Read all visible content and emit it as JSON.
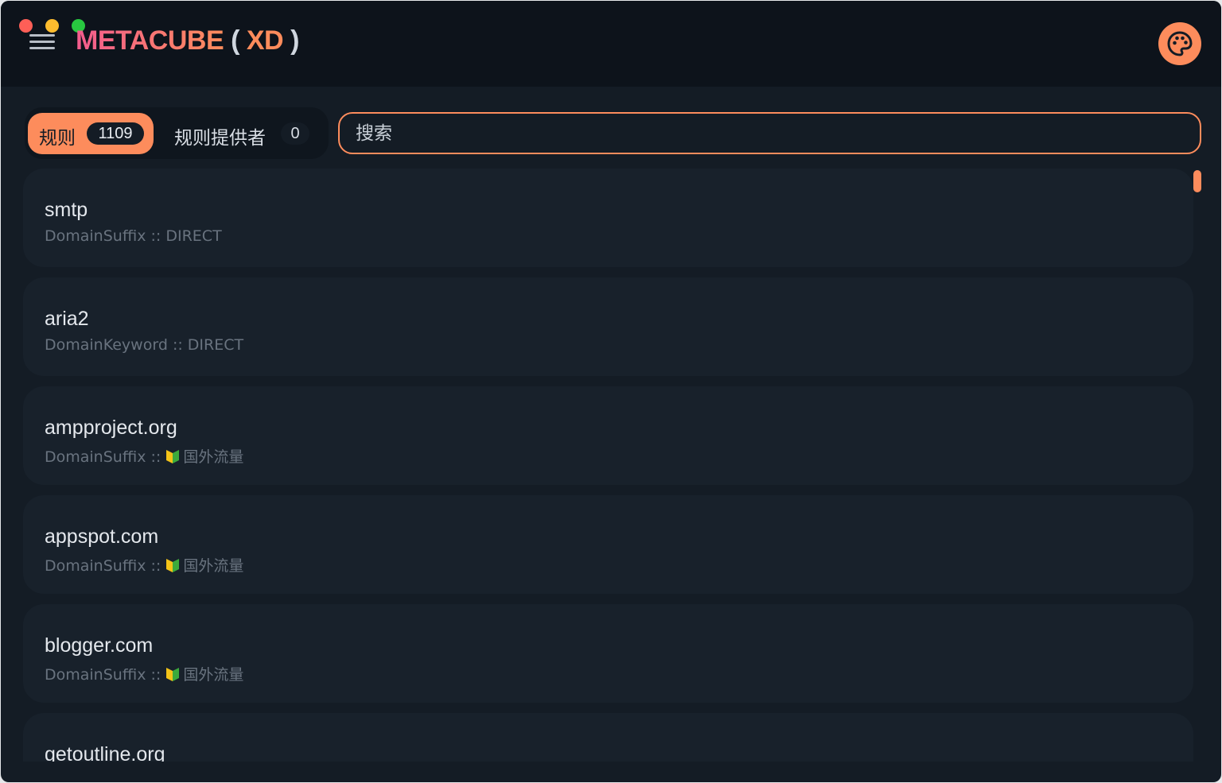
{
  "header": {
    "brand": "METACUBE",
    "paren_open": "(",
    "flavor": "XD",
    "paren_close": ")"
  },
  "tabs": [
    {
      "label": "规则",
      "count": "1109",
      "active": true
    },
    {
      "label": "规则提供者",
      "count": "0",
      "active": false
    }
  ],
  "search": {
    "placeholder": "搜索",
    "value": ""
  },
  "rules": [
    {
      "payload": "smtp",
      "type": "DomainSuffix",
      "separator": "::",
      "proxy": "DIRECT",
      "icon": ""
    },
    {
      "payload": "aria2",
      "type": "DomainKeyword",
      "separator": "::",
      "proxy": "DIRECT",
      "icon": ""
    },
    {
      "payload": "ampproject.org",
      "type": "DomainSuffix",
      "separator": "::",
      "proxy": "国外流量",
      "icon": "beginner-shield-icon"
    },
    {
      "payload": "appspot.com",
      "type": "DomainSuffix",
      "separator": "::",
      "proxy": "国外流量",
      "icon": "beginner-shield-icon"
    },
    {
      "payload": "blogger.com",
      "type": "DomainSuffix",
      "separator": "::",
      "proxy": "国外流量",
      "icon": "beginner-shield-icon"
    },
    {
      "payload": "getoutline.org",
      "type": "",
      "separator": "",
      "proxy": "",
      "icon": ""
    }
  ],
  "colors": {
    "accent": "#fd8c5c",
    "background": "#141c25",
    "titlebar": "#0d131b",
    "card": "#18212b"
  }
}
